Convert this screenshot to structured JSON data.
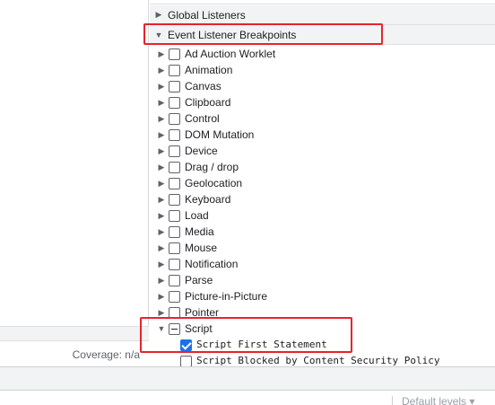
{
  "sections": {
    "global_listeners": "Global Listeners",
    "event_listener_breakpoints": "Event Listener Breakpoints"
  },
  "categories": [
    "Ad Auction Worklet",
    "Animation",
    "Canvas",
    "Clipboard",
    "Control",
    "DOM Mutation",
    "Device",
    "Drag / drop",
    "Geolocation",
    "Keyboard",
    "Load",
    "Media",
    "Mouse",
    "Notification",
    "Parse",
    "Picture-in-Picture",
    "Pointer"
  ],
  "script": {
    "label": "Script",
    "items": [
      {
        "label": "Script First Statement",
        "checked": true
      },
      {
        "label": "Script Blocked by Content Security Policy",
        "checked": false
      }
    ]
  },
  "left_panel": {
    "coverage": "Coverage: n/a"
  },
  "console": {
    "levels": "Default levels ▾"
  }
}
